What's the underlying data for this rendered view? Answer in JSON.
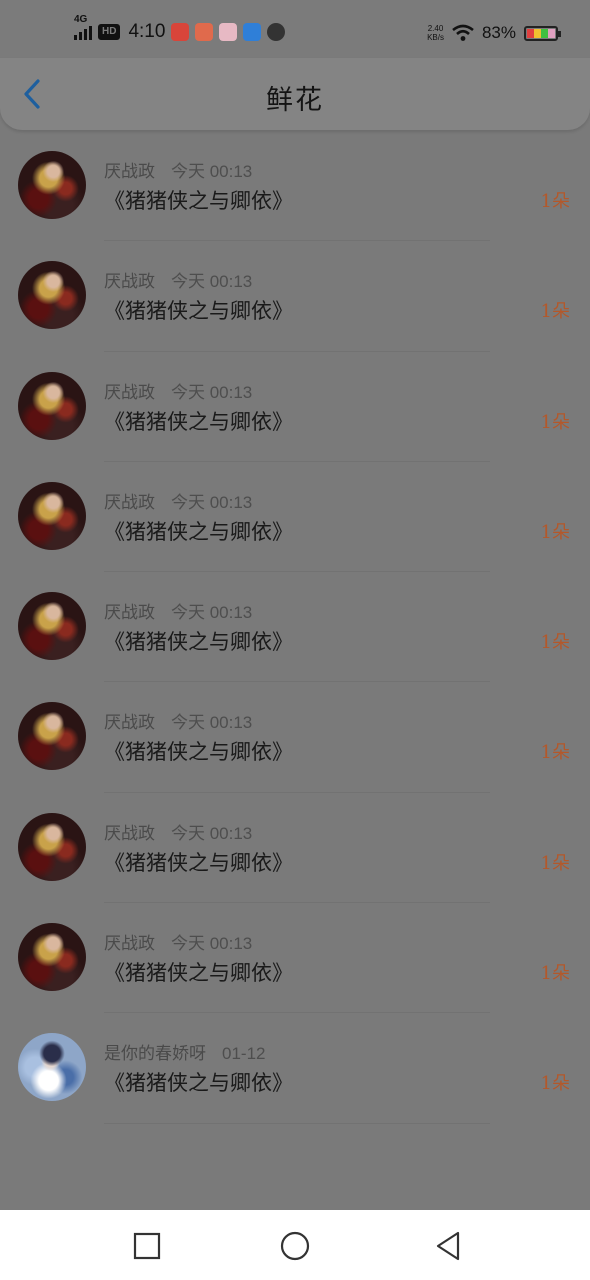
{
  "status_bar": {
    "network": "4G",
    "hd": "HD",
    "time": "4:10",
    "speed_value": "2.40",
    "speed_unit": "KB/s",
    "battery_percent": "83%",
    "battery_level": 0.83,
    "icons": [
      "signal-icon",
      "hd-icon",
      "app-icon-red",
      "app-icon-red-2",
      "app-icon-pink",
      "app-icon-blue",
      "app-icon-dark",
      "wifi-icon",
      "battery-icon"
    ]
  },
  "header": {
    "title": "鲜花",
    "back_icon": "chevron-left-icon"
  },
  "colors": {
    "accent": "#1e5f9e",
    "count": "#b4582a",
    "nav_bg": "#ffffff"
  },
  "flowers": [
    {
      "user": "厌战政",
      "time": "今天 00:13",
      "book": "《猪猪侠之与卿依》",
      "count": "1朵",
      "avatar": "dark"
    },
    {
      "user": "厌战政",
      "time": "今天 00:13",
      "book": "《猪猪侠之与卿依》",
      "count": "1朵",
      "avatar": "dark"
    },
    {
      "user": "厌战政",
      "time": "今天 00:13",
      "book": "《猪猪侠之与卿依》",
      "count": "1朵",
      "avatar": "dark"
    },
    {
      "user": "厌战政",
      "time": "今天 00:13",
      "book": "《猪猪侠之与卿依》",
      "count": "1朵",
      "avatar": "dark"
    },
    {
      "user": "厌战政",
      "time": "今天 00:13",
      "book": "《猪猪侠之与卿依》",
      "count": "1朵",
      "avatar": "dark"
    },
    {
      "user": "厌战政",
      "time": "今天 00:13",
      "book": "《猪猪侠之与卿依》",
      "count": "1朵",
      "avatar": "dark"
    },
    {
      "user": "厌战政",
      "time": "今天 00:13",
      "book": "《猪猪侠之与卿依》",
      "count": "1朵",
      "avatar": "dark"
    },
    {
      "user": "厌战政",
      "time": "今天 00:13",
      "book": "《猪猪侠之与卿依》",
      "count": "1朵",
      "avatar": "dark"
    },
    {
      "user": "是你的春娇呀",
      "time": "01-12",
      "book": "《猪猪侠之与卿依》",
      "count": "1朵",
      "avatar": "light"
    }
  ],
  "nav": {
    "icons": [
      "recent-apps-icon",
      "home-icon",
      "back-icon"
    ]
  }
}
